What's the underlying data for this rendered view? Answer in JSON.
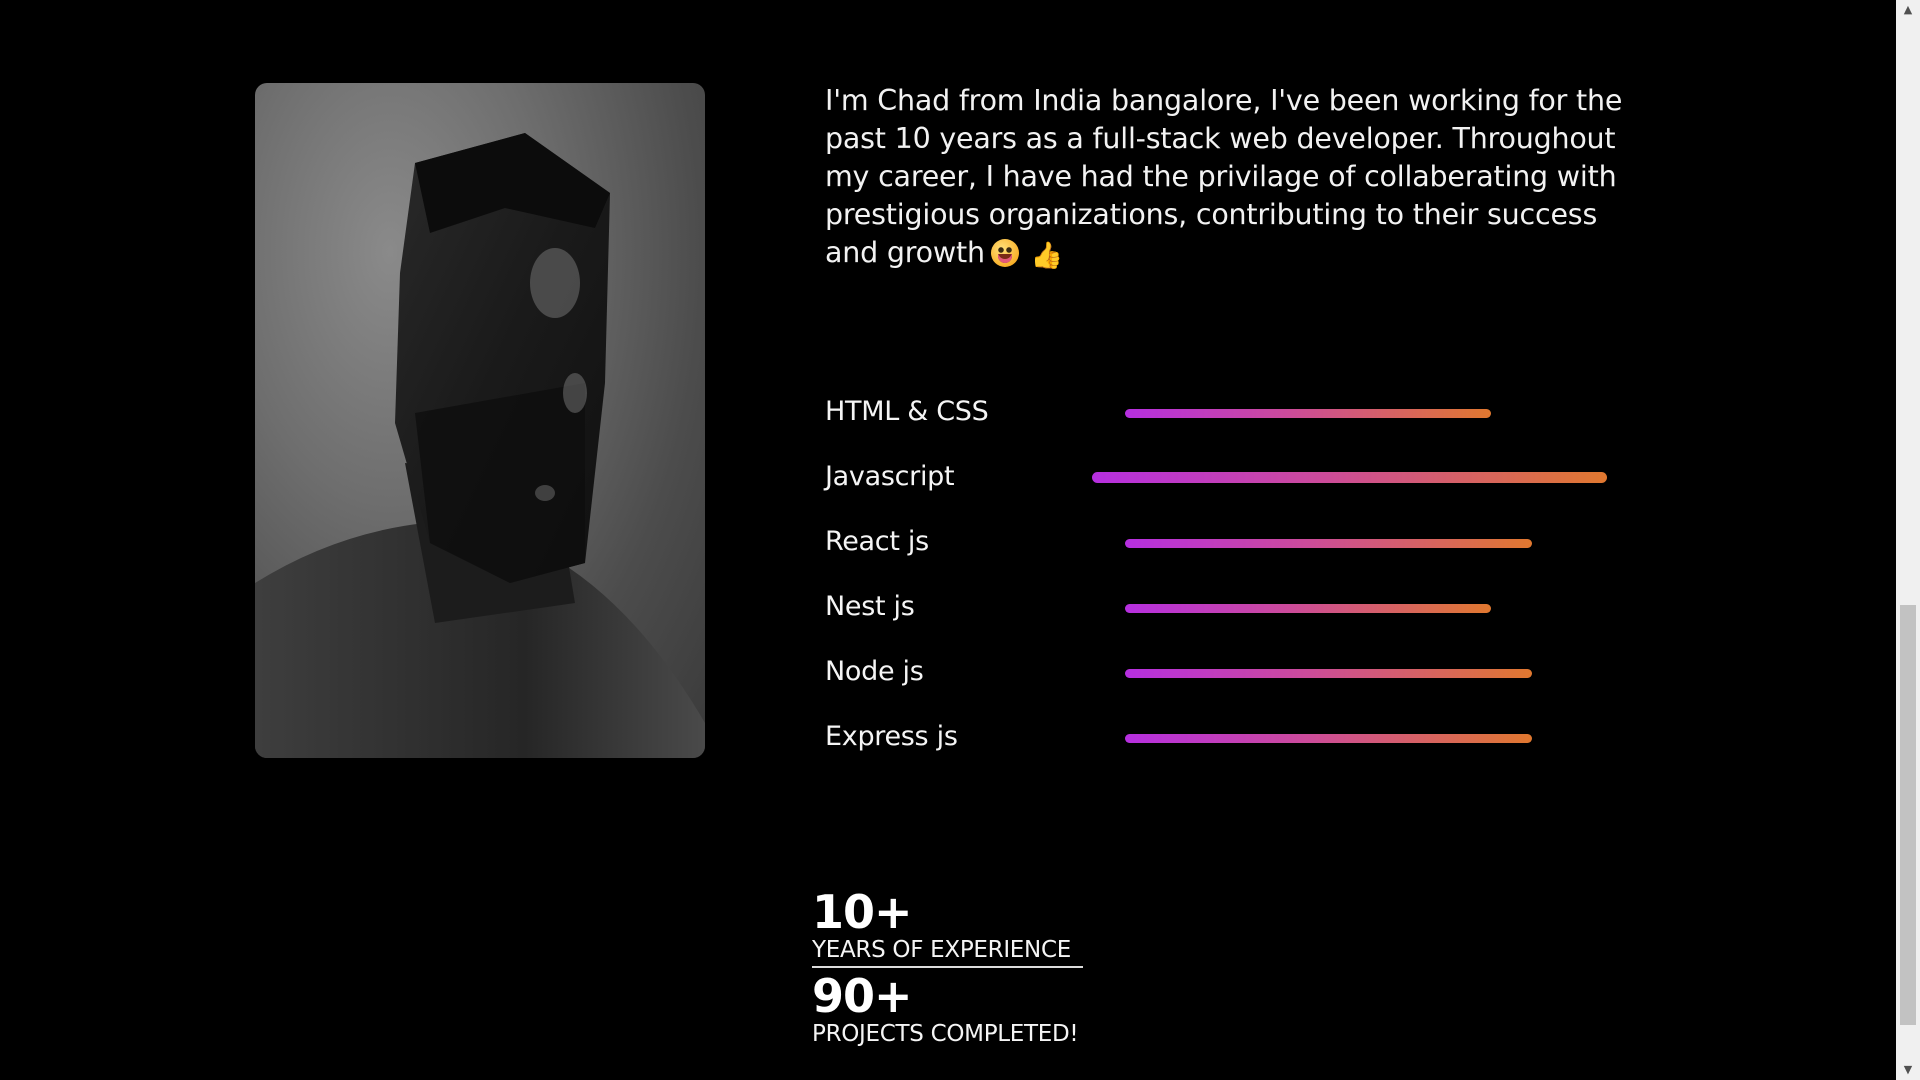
{
  "about": {
    "bio": "I'm Chad from India bangalore, I've been working for the past 10 years as a full-stack web developer. Throughout my career, I have had the privilage of collaberating with prestigious organizations, contributing to their success and growth",
    "emoji_face": "grinning-face-emoji",
    "emoji_thumb": "👍",
    "portrait_icon": "profile-photo"
  },
  "skills": [
    {
      "label": "HTML & CSS",
      "level": 0.71
    },
    {
      "label": "Javascript",
      "level": 1.0
    },
    {
      "label": "React js",
      "level": 0.79
    },
    {
      "label": "Nest js",
      "level": 0.71
    },
    {
      "label": "Node js",
      "level": 0.79
    },
    {
      "label": "Express js",
      "level": 0.79
    }
  ],
  "skill_bar_colors": [
    "#b62fe0",
    "#cc4b9a",
    "#e0782f"
  ],
  "stats": [
    {
      "number": "10+",
      "caption": "YEARS OF EXPERIENCE"
    },
    {
      "number": "90+",
      "caption": "PROJECTS COMPLETED!"
    }
  ]
}
